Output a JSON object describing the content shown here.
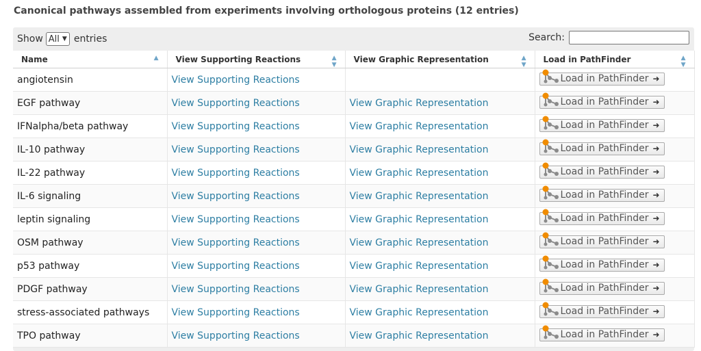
{
  "title": "Canonical pathways assembled from experiments involving orthologous proteins (12 entries)",
  "controls": {
    "show_label": "Show",
    "show_value": "All",
    "entries_label": "entries",
    "search_label": "Search:",
    "search_value": ""
  },
  "columns": [
    "Name",
    "View Supporting Reactions",
    "View Graphic Representation",
    "Load in PathFinder"
  ],
  "rows": [
    {
      "name": "angiotensin",
      "reactions": "View Supporting Reactions",
      "graphic": "",
      "load": "Load in PathFinder"
    },
    {
      "name": "EGF pathway",
      "reactions": "View Supporting Reactions",
      "graphic": "View Graphic Representation",
      "load": "Load in PathFinder"
    },
    {
      "name": "IFNalpha/beta pathway",
      "reactions": "View Supporting Reactions",
      "graphic": "View Graphic Representation",
      "load": "Load in PathFinder"
    },
    {
      "name": "IL-10 pathway",
      "reactions": "View Supporting Reactions",
      "graphic": "View Graphic Representation",
      "load": "Load in PathFinder"
    },
    {
      "name": "IL-22 pathway",
      "reactions": "View Supporting Reactions",
      "graphic": "View Graphic Representation",
      "load": "Load in PathFinder"
    },
    {
      "name": "IL-6 signaling",
      "reactions": "View Supporting Reactions",
      "graphic": "View Graphic Representation",
      "load": "Load in PathFinder"
    },
    {
      "name": "leptin signaling",
      "reactions": "View Supporting Reactions",
      "graphic": "View Graphic Representation",
      "load": "Load in PathFinder"
    },
    {
      "name": "OSM pathway",
      "reactions": "View Supporting Reactions",
      "graphic": "View Graphic Representation",
      "load": "Load in PathFinder"
    },
    {
      "name": "p53 pathway",
      "reactions": "View Supporting Reactions",
      "graphic": "View Graphic Representation",
      "load": "Load in PathFinder"
    },
    {
      "name": "PDGF pathway",
      "reactions": "View Supporting Reactions",
      "graphic": "View Graphic Representation",
      "load": "Load in PathFinder"
    },
    {
      "name": "stress-associated pathways",
      "reactions": "View Supporting Reactions",
      "graphic": "View Graphic Representation",
      "load": "Load in PathFinder"
    },
    {
      "name": "TPO pathway",
      "reactions": "View Supporting Reactions",
      "graphic": "View Graphic Representation",
      "load": "Load in PathFinder"
    }
  ],
  "icons": {
    "sort_asc": "sort-ascending-icon",
    "sort_both": "sort-both-icon",
    "pathfinder": "pathfinder-network-icon",
    "arrow": "arrow-right-icon"
  },
  "colors": {
    "link": "#2d7ea3",
    "node_orange": "#f08c00",
    "node_gray": "#8a8a8a"
  }
}
